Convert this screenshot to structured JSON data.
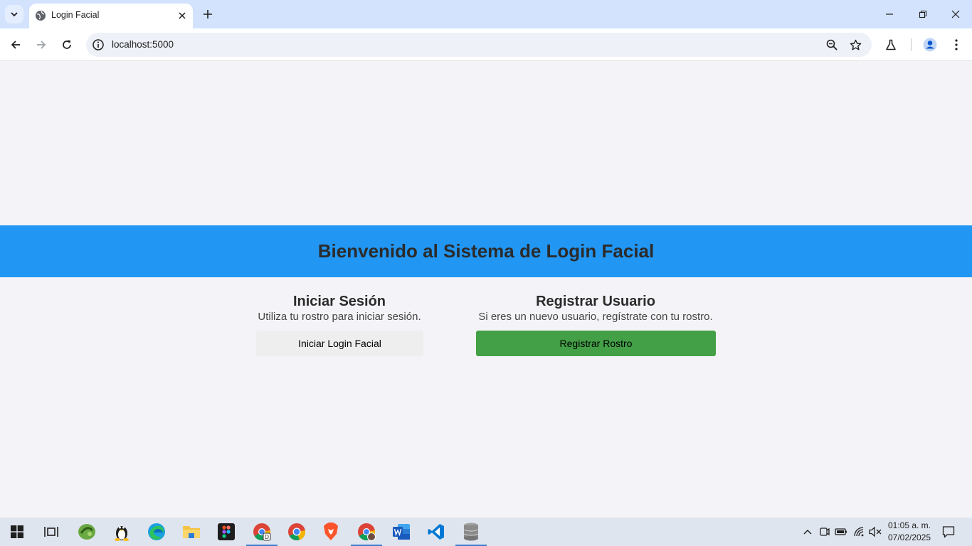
{
  "browser": {
    "tab_title": "Login Facial",
    "url": "localhost:5000"
  },
  "page": {
    "banner_title": "Bienvenido al Sistema de Login Facial",
    "login": {
      "heading": "Iniciar Sesión",
      "description": "Utiliza tu rostro para iniciar sesión.",
      "button_label": "Iniciar Login Facial"
    },
    "register": {
      "heading": "Registrar Usuario",
      "description": "Si eres un nuevo usuario, regístrate con tu rostro.",
      "button_label": "Registrar Rostro"
    }
  },
  "taskbar": {
    "time": "01:05 a. m.",
    "date": "07/02/2025",
    "apps": [
      "start-icon",
      "task-view-icon",
      "app-green-icon",
      "linux-icon",
      "edge-icon",
      "file-explorer-icon",
      "figma-icon",
      "chrome-dev-icon",
      "chrome-icon",
      "brave-icon",
      "chrome-profile-icon",
      "word-icon",
      "vscode-icon",
      "database-icon"
    ]
  },
  "colors": {
    "banner": "#2196f3",
    "register_button": "#43a047",
    "login_button": "#eeeeee",
    "page_background": "#f4f4f8",
    "tabbar": "#d3e3fd"
  }
}
